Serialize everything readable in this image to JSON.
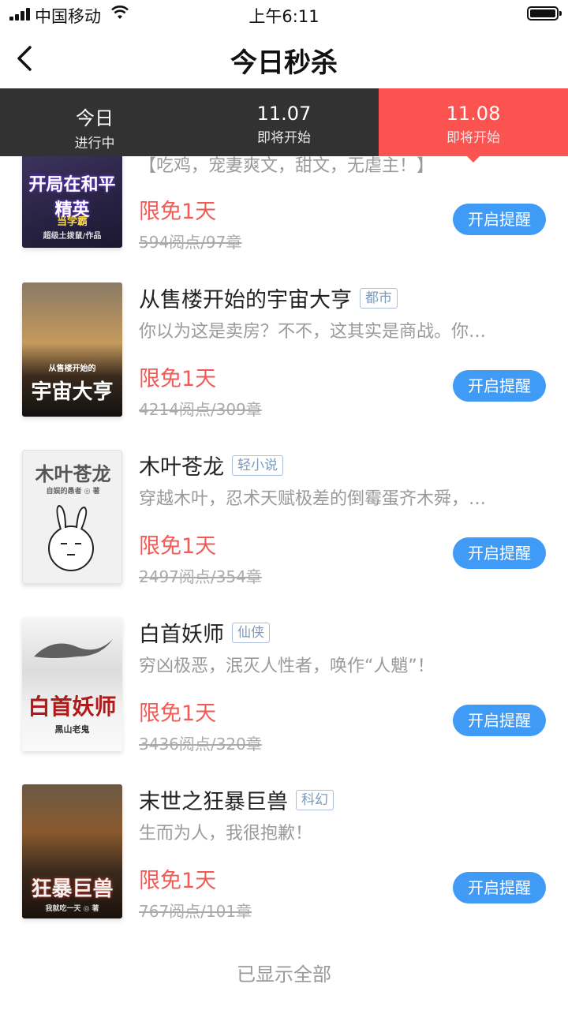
{
  "status_bar": {
    "carrier": "中国移动",
    "time": "上午6:11"
  },
  "nav": {
    "title": "今日秒杀"
  },
  "tabs": [
    {
      "label": "今日",
      "sub": "进行中",
      "active": false
    },
    {
      "label": "11.07",
      "sub": "即将开始",
      "active": false
    },
    {
      "label": "11.08",
      "sub": "即将开始",
      "active": true
    }
  ],
  "books": [
    {
      "title": "",
      "tag": "",
      "desc": "【吃鸡，宠妻爽文，甜文，无虐主！】",
      "free": "限免1天",
      "stats": "594阅点/97章",
      "button": "开启提醒",
      "cover_text": "开局在和平精英",
      "cover_sub": "当学霸",
      "cover_author": "超级土拨鼠/作品"
    },
    {
      "title": "从售楼开始的宇宙大亨",
      "tag": "都市",
      "desc": "你以为这是卖房？不不，这其实是商战。你…",
      "free": "限免1天",
      "stats": "4214阅点/309章",
      "button": "开启提醒",
      "cover_text": "宇宙大亨",
      "cover_sub": "从售楼开始的"
    },
    {
      "title": "木叶苍龙",
      "tag": "轻小说",
      "desc": "穿越木叶，忍术天赋极差的倒霉蛋齐木舜，…",
      "free": "限免1天",
      "stats": "2497阅点/354章",
      "button": "开启提醒",
      "cover_text": "木叶苍龙",
      "cover_sub": "自娱的愚者 ◎ 著"
    },
    {
      "title": "白首妖师",
      "tag": "仙侠",
      "desc": "穷凶极恶，泯灭人性者，唤作“人魈”！",
      "free": "限免1天",
      "stats": "3436阅点/320章",
      "button": "开启提醒",
      "cover_text": "白首妖师",
      "cover_sub": "黑山老鬼"
    },
    {
      "title": "末世之狂暴巨兽",
      "tag": "科幻",
      "desc": "生而为人，我很抱歉！",
      "free": "限免1天",
      "stats": "767阅点/101章",
      "button": "开启提醒",
      "cover_text": "狂暴巨兽",
      "cover_sub": "我就吃一天 ◎ 著"
    }
  ],
  "footer": "已显示全部"
}
